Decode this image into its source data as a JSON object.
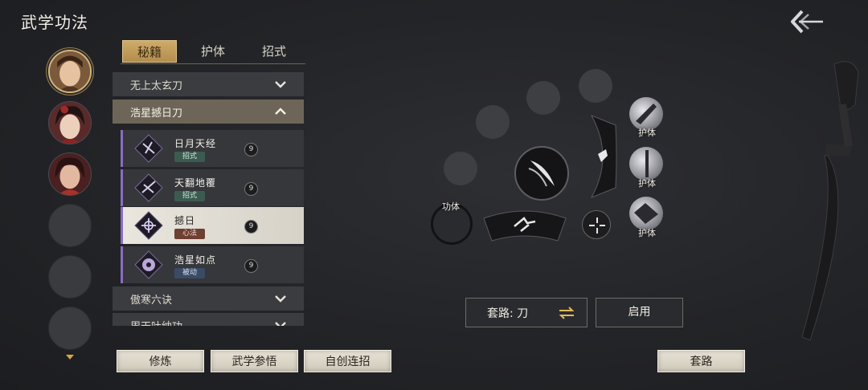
{
  "header": {
    "title": "武学功法"
  },
  "tabs": [
    {
      "label": "秘籍"
    },
    {
      "label": "护体"
    },
    {
      "label": "招式"
    }
  ],
  "categories": {
    "c1": "无上太玄刀",
    "c2": "浩星撼日刀",
    "c3": "傲寒六诀",
    "c4": "周天吐纳功"
  },
  "skills": [
    {
      "name": "日月天经",
      "tag": "招式",
      "badge": "9"
    },
    {
      "name": "天翻地覆",
      "tag": "招式",
      "badge": "9"
    },
    {
      "name": "撼日",
      "tag": "心法",
      "badge": "9"
    },
    {
      "name": "浩星如点",
      "tag": "被动",
      "badge": "9"
    }
  ],
  "buttons": {
    "practice": "修炼",
    "comprehend": "武学参悟",
    "custom_combo": "自创连招",
    "routine": "套路"
  },
  "wheel": {
    "gongti": "功体",
    "huti1": "护体",
    "huti2": "护体",
    "huti3": "护体"
  },
  "routine_box": {
    "label": "套路: 刀",
    "enable": "启用"
  },
  "colors": {
    "accent_gold": "#cfab6a",
    "selected_purple": "#8a6cc0",
    "tag_green": "#3c5b50",
    "tag_brown": "#6e3f33",
    "tag_blue": "#3a4b66"
  }
}
